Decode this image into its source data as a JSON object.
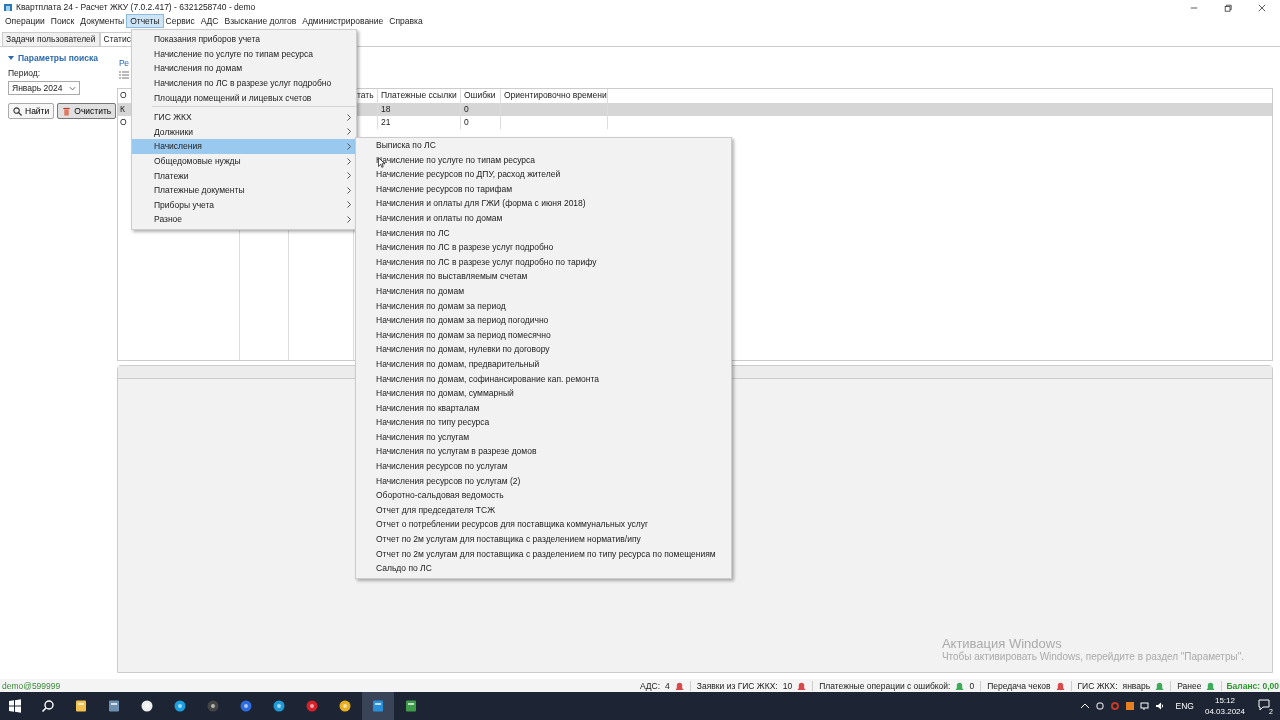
{
  "window": {
    "title": "Квартплата 24 - Расчет ЖКУ (7.0.2.417) - 6321258740 - demo"
  },
  "menu_bar": [
    {
      "label": "Операции",
      "selected": false
    },
    {
      "label": "Поиск",
      "selected": false
    },
    {
      "label": "Документы",
      "selected": false
    },
    {
      "label": "Отчеты",
      "selected": true
    },
    {
      "label": "Сервис",
      "selected": false
    },
    {
      "label": "АДС",
      "selected": false
    },
    {
      "label": "Взыскание долгов",
      "selected": false
    },
    {
      "label": "Администрирование",
      "selected": false
    },
    {
      "label": "Справка",
      "selected": false
    }
  ],
  "tabs": [
    {
      "label": "Задачи пользователей",
      "selected": false
    },
    {
      "label": "Статис",
      "selected": true
    }
  ],
  "search_panel": {
    "title": "Параметры поиска",
    "expanded": true,
    "period_label": "Период:",
    "period_value": "Январь 2024",
    "buttons": [
      "Найти",
      "Очистить"
    ]
  },
  "results": {
    "title": "Ре",
    "columns": [
      "О",
      "тать",
      "Платежные ссылки",
      "Ошибки",
      "Ориентировочно времени"
    ],
    "rows": [
      {
        "org": "К",
        "links": "18",
        "errors": "0",
        "selected": true
      },
      {
        "org": "О",
        "links": "21",
        "errors": "0",
        "selected": false
      }
    ]
  },
  "reports_menu": {
    "items": [
      {
        "kind": "item",
        "label": "Показания приборов учета",
        "selected": false
      },
      {
        "kind": "item",
        "label": "Начисление по услуге по типам ресурса",
        "selected": false
      },
      {
        "kind": "item",
        "label": "Начисления по домам",
        "selected": false
      },
      {
        "kind": "item",
        "label": "Начисления по ЛС в разрезе услуг подробно",
        "selected": false
      },
      {
        "kind": "item",
        "label": "Площади помещений и лицевых счетов",
        "selected": false
      },
      {
        "kind": "separator"
      },
      {
        "kind": "submenu",
        "label": "ГИС ЖКХ",
        "selected": false
      },
      {
        "kind": "submenu",
        "label": "Должники",
        "selected": false
      },
      {
        "kind": "submenu",
        "label": "Начисления",
        "selected": true
      },
      {
        "kind": "submenu",
        "label": "Общедомовые нужды",
        "selected": false
      },
      {
        "kind": "submenu",
        "label": "Платежи",
        "selected": false
      },
      {
        "kind": "submenu",
        "label": "Платежные документы",
        "selected": false
      },
      {
        "kind": "submenu",
        "label": "Приборы учета",
        "selected": false
      },
      {
        "kind": "submenu",
        "label": "Разное",
        "selected": false
      }
    ]
  },
  "charges_submenu": [
    "Выписка по ЛС",
    "Начисление по услуге по типам ресурса",
    "Начисление ресурсов по ДПУ, расход жителей",
    "Начисление ресурсов по тарифам",
    "Начисления и оплаты для ГЖИ (форма с июня 2018)",
    "Начисления и оплаты по домам",
    "Начисления по ЛС",
    "Начисления по ЛС в разрезе услуг подробно",
    "Начисления по ЛС в разрезе услуг подробно по тарифу",
    "Начисления по выставляемым счетам",
    "Начисления по домам",
    "Начисления по домам за период",
    "Начисления по домам за период погодично",
    "Начисления по домам за период помесячно",
    "Начисления по домам, нулевки по договору",
    "Начисления по домам, предварительный",
    "Начисления по домам, софинансирование кап. ремонта",
    "Начисления по домам, суммарный",
    "Начисления по кварталам",
    "Начисления по типу ресурса",
    "Начисления по услугам",
    "Начисления по услугам в разрезе домов",
    "Начисления ресурсов по услугам",
    "Начисления ресурсов по услугам (2)",
    "Оборотно-сальдовая ведомость",
    "Отчет для председателя ТСЖ",
    "Отчет о потреблении ресурсов для поставщика коммунальных услуг",
    "Отчет по 2м услугам для поставщика с разделением норматив/ипу",
    "Отчет по 2м услугам для поставщика с разделением по типу ресурса по помещениям",
    "Сальдо по ЛС"
  ],
  "activation_notice": {
    "title": "Активация Windows",
    "text": "Чтобы активировать Windows, перейдите в раздел \"Параметры\"."
  },
  "status_bar": {
    "user": "demo@599999",
    "indicators": [
      {
        "kind": "value_first",
        "label": "АДС:",
        "value": "4",
        "color": "#d84a4a"
      },
      {
        "kind": "value_first",
        "label": "Заявки из ГИС ЖКХ:",
        "value": "10",
        "color": "#d84a4a"
      },
      {
        "kind": "icon_first",
        "label": "Платежные операции с ошибкой:",
        "value": "0",
        "color": "#3faa5a"
      },
      {
        "kind": "icon_first",
        "label": "Передача чеков",
        "color": "#d84a4a"
      },
      {
        "kind": "value_first",
        "label": "ГИС ЖКХ:",
        "value": "январь",
        "color": "#3faa5a"
      },
      {
        "kind": "value_first",
        "label": "Ранее",
        "color": "#3faa5a"
      }
    ],
    "balance": "Баланс: 0,00"
  },
  "taskbar": {
    "language": "ENG",
    "time": "15:12",
    "date": "04.03.2024",
    "notifications": "2"
  }
}
